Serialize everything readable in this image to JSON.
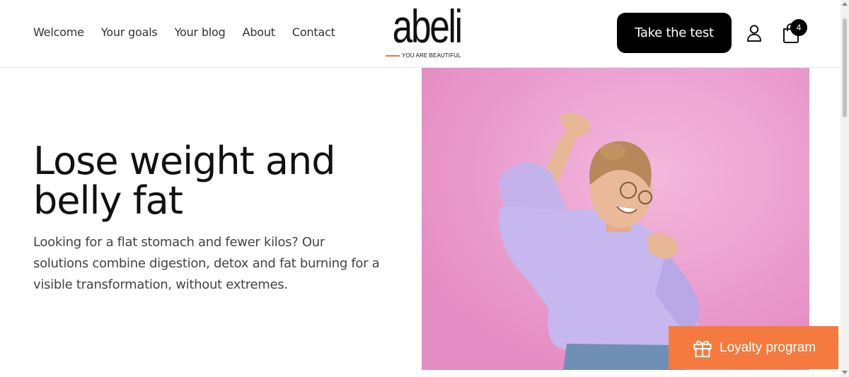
{
  "nav": {
    "items": [
      {
        "label": "Welcome"
      },
      {
        "label": "Your goals"
      },
      {
        "label": "Your blog"
      },
      {
        "label": "About"
      },
      {
        "label": "Contact"
      }
    ]
  },
  "logo": {
    "wordmark": "abeli",
    "tagline": "YOU ARE BEAUTIFUL",
    "accent_color": "#e8704a"
  },
  "header": {
    "cta_label": "Take the test",
    "account_icon": "user-icon",
    "cart_icon": "shopping-bag-icon",
    "cart_count": "4"
  },
  "hero": {
    "title": "Lose weight and belly fat",
    "text": "Looking for a flat stomach and fewer kilos? Our solutions combine digestion, detox and fat burning for a visible transformation, without extremes.",
    "image_background": "#f0a7d6"
  },
  "loyalty": {
    "label": "Loyalty program",
    "icon": "gift-icon",
    "color": "#f47a3f"
  }
}
